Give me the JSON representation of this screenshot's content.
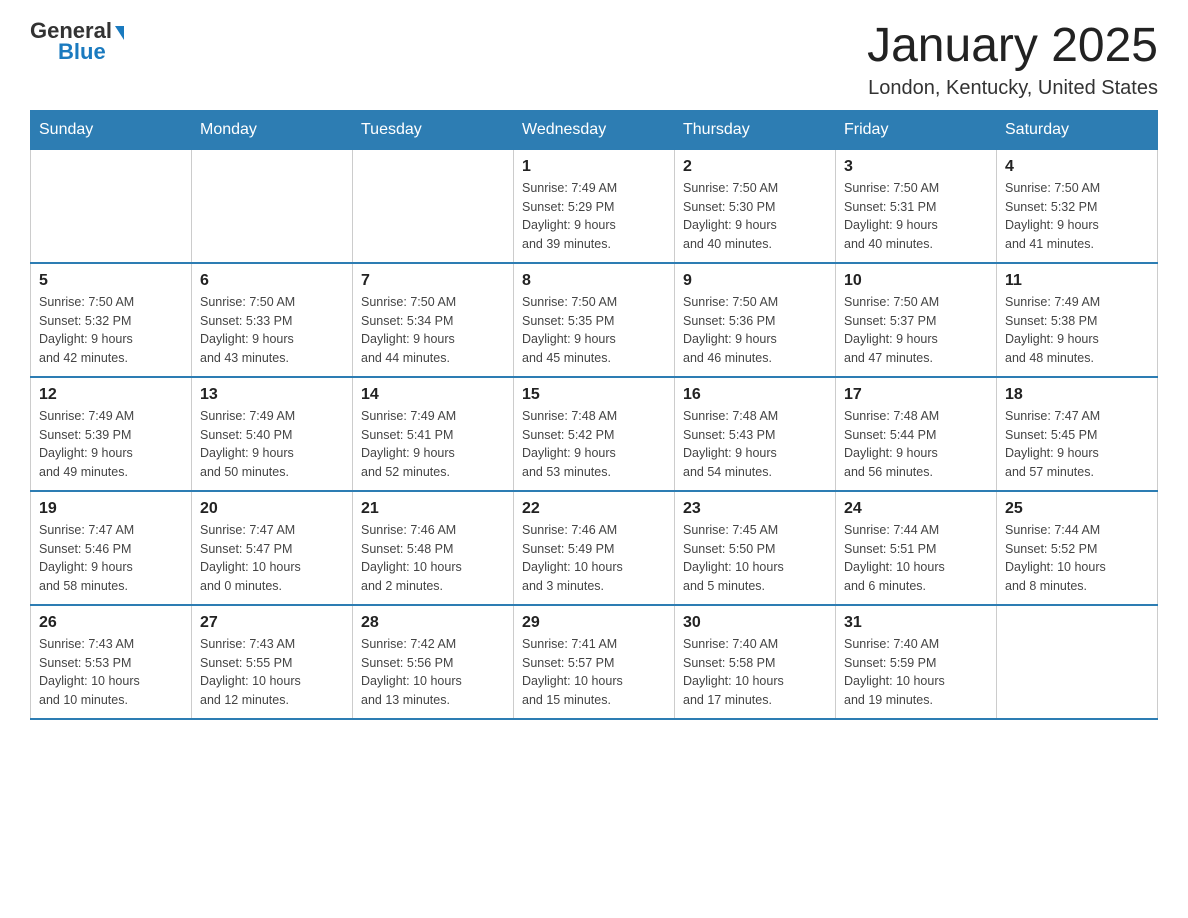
{
  "logo": {
    "general": "General",
    "blue": "Blue",
    "triangle": "▾"
  },
  "title": "January 2025",
  "subtitle": "London, Kentucky, United States",
  "days_of_week": [
    "Sunday",
    "Monday",
    "Tuesday",
    "Wednesday",
    "Thursday",
    "Friday",
    "Saturday"
  ],
  "weeks": [
    [
      {
        "day": "",
        "info": ""
      },
      {
        "day": "",
        "info": ""
      },
      {
        "day": "",
        "info": ""
      },
      {
        "day": "1",
        "info": "Sunrise: 7:49 AM\nSunset: 5:29 PM\nDaylight: 9 hours\nand 39 minutes."
      },
      {
        "day": "2",
        "info": "Sunrise: 7:50 AM\nSunset: 5:30 PM\nDaylight: 9 hours\nand 40 minutes."
      },
      {
        "day": "3",
        "info": "Sunrise: 7:50 AM\nSunset: 5:31 PM\nDaylight: 9 hours\nand 40 minutes."
      },
      {
        "day": "4",
        "info": "Sunrise: 7:50 AM\nSunset: 5:32 PM\nDaylight: 9 hours\nand 41 minutes."
      }
    ],
    [
      {
        "day": "5",
        "info": "Sunrise: 7:50 AM\nSunset: 5:32 PM\nDaylight: 9 hours\nand 42 minutes."
      },
      {
        "day": "6",
        "info": "Sunrise: 7:50 AM\nSunset: 5:33 PM\nDaylight: 9 hours\nand 43 minutes."
      },
      {
        "day": "7",
        "info": "Sunrise: 7:50 AM\nSunset: 5:34 PM\nDaylight: 9 hours\nand 44 minutes."
      },
      {
        "day": "8",
        "info": "Sunrise: 7:50 AM\nSunset: 5:35 PM\nDaylight: 9 hours\nand 45 minutes."
      },
      {
        "day": "9",
        "info": "Sunrise: 7:50 AM\nSunset: 5:36 PM\nDaylight: 9 hours\nand 46 minutes."
      },
      {
        "day": "10",
        "info": "Sunrise: 7:50 AM\nSunset: 5:37 PM\nDaylight: 9 hours\nand 47 minutes."
      },
      {
        "day": "11",
        "info": "Sunrise: 7:49 AM\nSunset: 5:38 PM\nDaylight: 9 hours\nand 48 minutes."
      }
    ],
    [
      {
        "day": "12",
        "info": "Sunrise: 7:49 AM\nSunset: 5:39 PM\nDaylight: 9 hours\nand 49 minutes."
      },
      {
        "day": "13",
        "info": "Sunrise: 7:49 AM\nSunset: 5:40 PM\nDaylight: 9 hours\nand 50 minutes."
      },
      {
        "day": "14",
        "info": "Sunrise: 7:49 AM\nSunset: 5:41 PM\nDaylight: 9 hours\nand 52 minutes."
      },
      {
        "day": "15",
        "info": "Sunrise: 7:48 AM\nSunset: 5:42 PM\nDaylight: 9 hours\nand 53 minutes."
      },
      {
        "day": "16",
        "info": "Sunrise: 7:48 AM\nSunset: 5:43 PM\nDaylight: 9 hours\nand 54 minutes."
      },
      {
        "day": "17",
        "info": "Sunrise: 7:48 AM\nSunset: 5:44 PM\nDaylight: 9 hours\nand 56 minutes."
      },
      {
        "day": "18",
        "info": "Sunrise: 7:47 AM\nSunset: 5:45 PM\nDaylight: 9 hours\nand 57 minutes."
      }
    ],
    [
      {
        "day": "19",
        "info": "Sunrise: 7:47 AM\nSunset: 5:46 PM\nDaylight: 9 hours\nand 58 minutes."
      },
      {
        "day": "20",
        "info": "Sunrise: 7:47 AM\nSunset: 5:47 PM\nDaylight: 10 hours\nand 0 minutes."
      },
      {
        "day": "21",
        "info": "Sunrise: 7:46 AM\nSunset: 5:48 PM\nDaylight: 10 hours\nand 2 minutes."
      },
      {
        "day": "22",
        "info": "Sunrise: 7:46 AM\nSunset: 5:49 PM\nDaylight: 10 hours\nand 3 minutes."
      },
      {
        "day": "23",
        "info": "Sunrise: 7:45 AM\nSunset: 5:50 PM\nDaylight: 10 hours\nand 5 minutes."
      },
      {
        "day": "24",
        "info": "Sunrise: 7:44 AM\nSunset: 5:51 PM\nDaylight: 10 hours\nand 6 minutes."
      },
      {
        "day": "25",
        "info": "Sunrise: 7:44 AM\nSunset: 5:52 PM\nDaylight: 10 hours\nand 8 minutes."
      }
    ],
    [
      {
        "day": "26",
        "info": "Sunrise: 7:43 AM\nSunset: 5:53 PM\nDaylight: 10 hours\nand 10 minutes."
      },
      {
        "day": "27",
        "info": "Sunrise: 7:43 AM\nSunset: 5:55 PM\nDaylight: 10 hours\nand 12 minutes."
      },
      {
        "day": "28",
        "info": "Sunrise: 7:42 AM\nSunset: 5:56 PM\nDaylight: 10 hours\nand 13 minutes."
      },
      {
        "day": "29",
        "info": "Sunrise: 7:41 AM\nSunset: 5:57 PM\nDaylight: 10 hours\nand 15 minutes."
      },
      {
        "day": "30",
        "info": "Sunrise: 7:40 AM\nSunset: 5:58 PM\nDaylight: 10 hours\nand 17 minutes."
      },
      {
        "day": "31",
        "info": "Sunrise: 7:40 AM\nSunset: 5:59 PM\nDaylight: 10 hours\nand 19 minutes."
      },
      {
        "day": "",
        "info": ""
      }
    ]
  ]
}
